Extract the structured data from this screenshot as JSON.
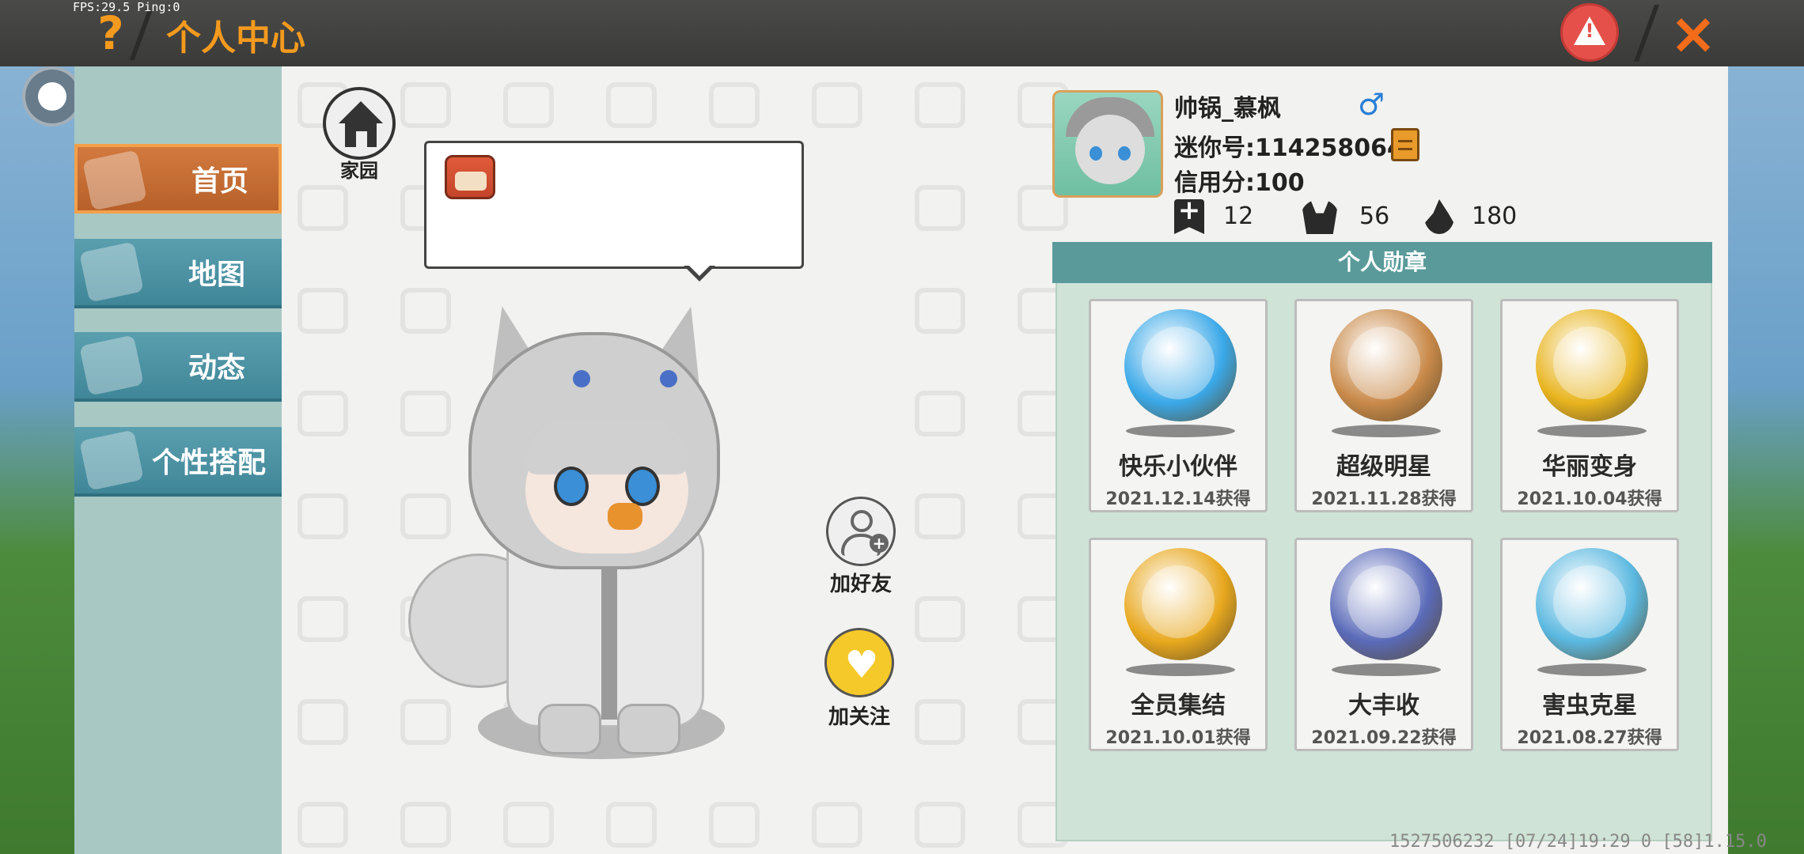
{
  "hud": {
    "fps_text": "FPS:29.5  Ping:0"
  },
  "header": {
    "title": "个人中心",
    "help_icon": "?",
    "report_icon": "warning-icon",
    "close_icon": "×"
  },
  "nav": {
    "items": [
      {
        "label": "首页",
        "icon": "shirt-icon",
        "active": true
      },
      {
        "label": "地图",
        "icon": "map-icon",
        "active": false
      },
      {
        "label": "动态",
        "icon": "bell-icon",
        "active": false
      },
      {
        "label": "个性搭配",
        "icon": "closet-icon",
        "active": false
      }
    ]
  },
  "home": {
    "label": "家园",
    "icon": "house-icon"
  },
  "actions": {
    "add_friend_label": "加好友",
    "follow_label": "加关注",
    "follow_icon": "♥"
  },
  "profile": {
    "username": "帅锅_慕枫",
    "gender_icon": "♂",
    "mini_id": "迷你号:1142580648",
    "credit": "信用分:100",
    "stats": [
      {
        "icon": "bookmark-plus-icon",
        "value": "12"
      },
      {
        "icon": "fans-icon",
        "value": "56"
      },
      {
        "icon": "fire-icon",
        "value": "180"
      }
    ]
  },
  "medals": {
    "title": "个人勋章",
    "items": [
      {
        "name": "快乐小伙伴",
        "date": "2021.12.14获得",
        "color": "#3aa8e8"
      },
      {
        "name": "超级明星",
        "date": "2021.11.28获得",
        "color": "#c98a4a"
      },
      {
        "name": "华丽变身",
        "date": "2021.10.04获得",
        "color": "#e8b41e"
      },
      {
        "name": "全员集结",
        "date": "2021.10.01获得",
        "color": "#e8a81e"
      },
      {
        "name": "大丰收",
        "date": "2021.09.22获得",
        "color": "#5a6ab8"
      },
      {
        "name": "害虫克星",
        "date": "2021.08.27获得",
        "color": "#5ab8e0"
      }
    ]
  },
  "footer": {
    "text": "1527506232    [07/24]19:29 0  [58]1.15.0"
  }
}
